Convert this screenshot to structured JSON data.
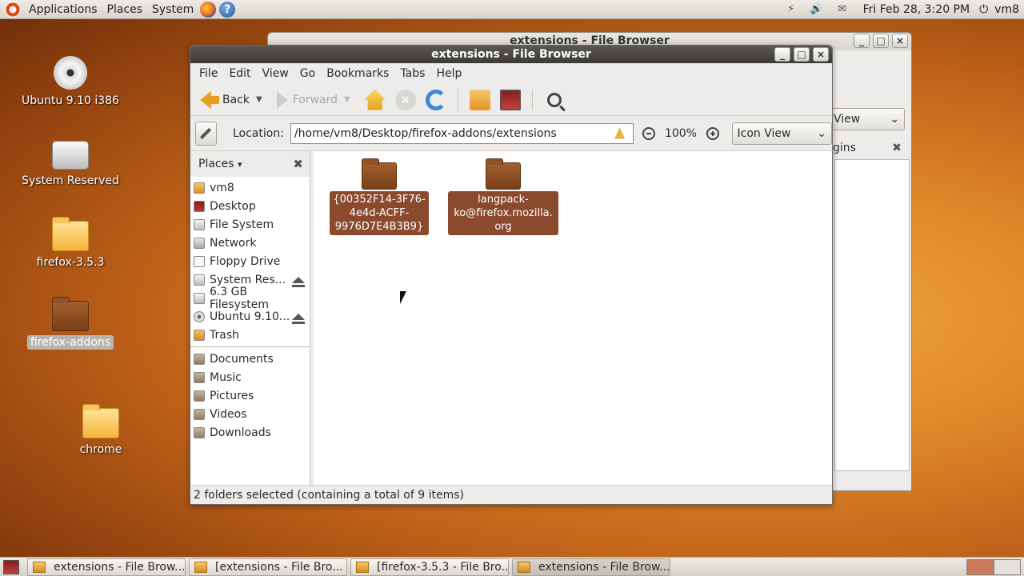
{
  "top_panel": {
    "menus": [
      "Applications",
      "Places",
      "System"
    ],
    "clock": "Fri Feb 28,  3:20 PM",
    "user": "vm8"
  },
  "desktop_icons": [
    {
      "label": "Ubuntu 9.10 i386"
    },
    {
      "label": "System Reserved"
    },
    {
      "label": "firefox-3.5.3"
    },
    {
      "label": "firefox-addons"
    },
    {
      "label": "chrome"
    }
  ],
  "bg_window": {
    "title": "extensions - File Browser",
    "view_fragment": "View",
    "side_fragment": "gins"
  },
  "window": {
    "title": "extensions - File Browser",
    "menu": [
      "File",
      "Edit",
      "View",
      "Go",
      "Bookmarks",
      "Tabs",
      "Help"
    ],
    "toolbar": {
      "back": "Back",
      "forward": "Forward"
    },
    "location_label": "Location:",
    "location_value": "/home/vm8/Desktop/firefox-addons/extensions",
    "zoom": "100%",
    "view_mode": "Icon View",
    "sidebar_title": "Places",
    "places": [
      "vm8",
      "Desktop",
      "File System",
      "Network",
      "Floppy Drive",
      "System Res...",
      "6.3 GB Filesystem",
      "Ubuntu 9.10...",
      "Trash"
    ],
    "bookmarks": [
      "Documents",
      "Music",
      "Pictures",
      "Videos",
      "Downloads"
    ],
    "items": [
      {
        "line1": "{00352F14-3F76-",
        "line2": "4e4d-ACFF-",
        "line3": "9976D7E4B3B9}"
      },
      {
        "line1": "langpack-",
        "line2": "ko@firefox.mozilla.",
        "line3": "org"
      }
    ],
    "status": "2 folders selected (containing a total of 9 items)"
  },
  "taskbar": [
    "extensions - File Brow...",
    "[extensions - File Bro...",
    "[firefox-3.5.3 - File Bro...",
    "extensions - File Brow..."
  ]
}
